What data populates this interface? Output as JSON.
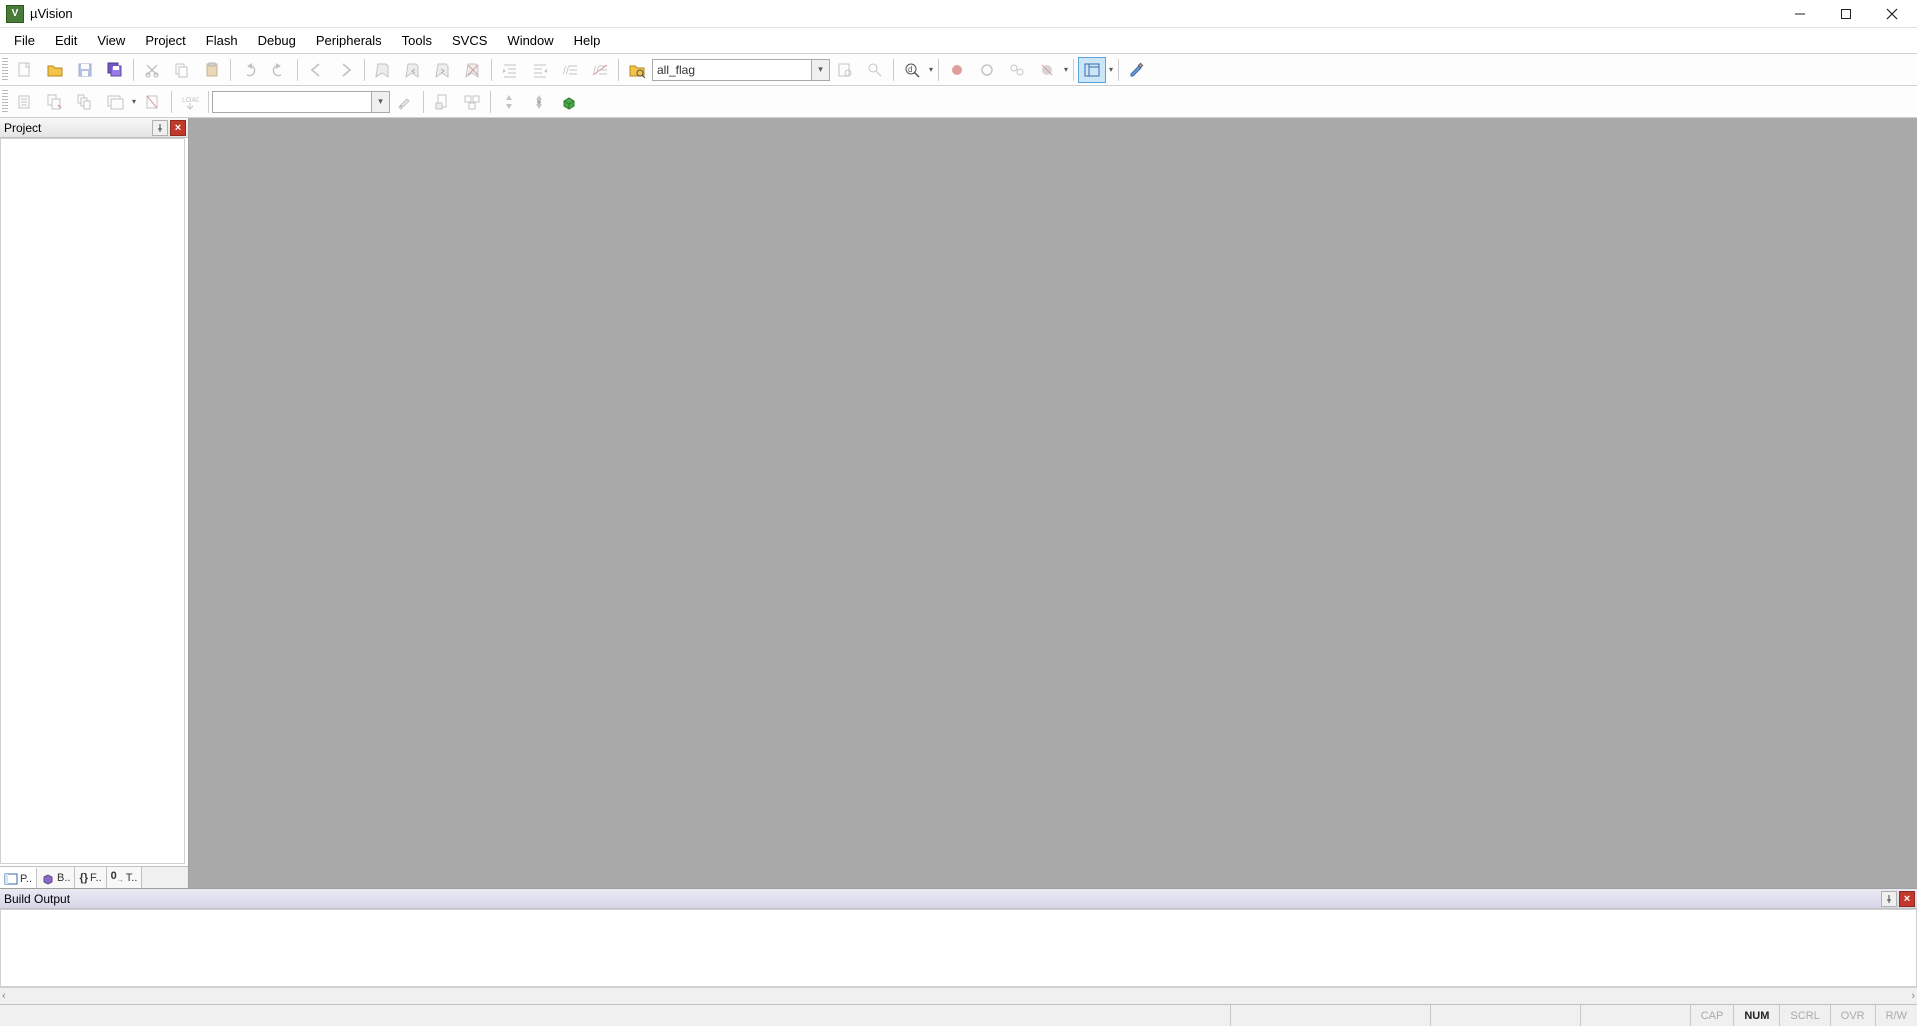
{
  "title": "µVision",
  "menu": [
    "File",
    "Edit",
    "View",
    "Project",
    "Flash",
    "Debug",
    "Peripherals",
    "Tools",
    "SVCS",
    "Window",
    "Help"
  ],
  "toolbar1": {
    "find_combo": "all_flag"
  },
  "toolbar2": {
    "target_combo": ""
  },
  "project_panel": {
    "title": "Project",
    "tabs": [
      "P..",
      "B..",
      "F..",
      "T.."
    ]
  },
  "build_output": {
    "title": "Build Output"
  },
  "status": [
    "CAP",
    "NUM",
    "SCRL",
    "OVR",
    "R/W"
  ]
}
